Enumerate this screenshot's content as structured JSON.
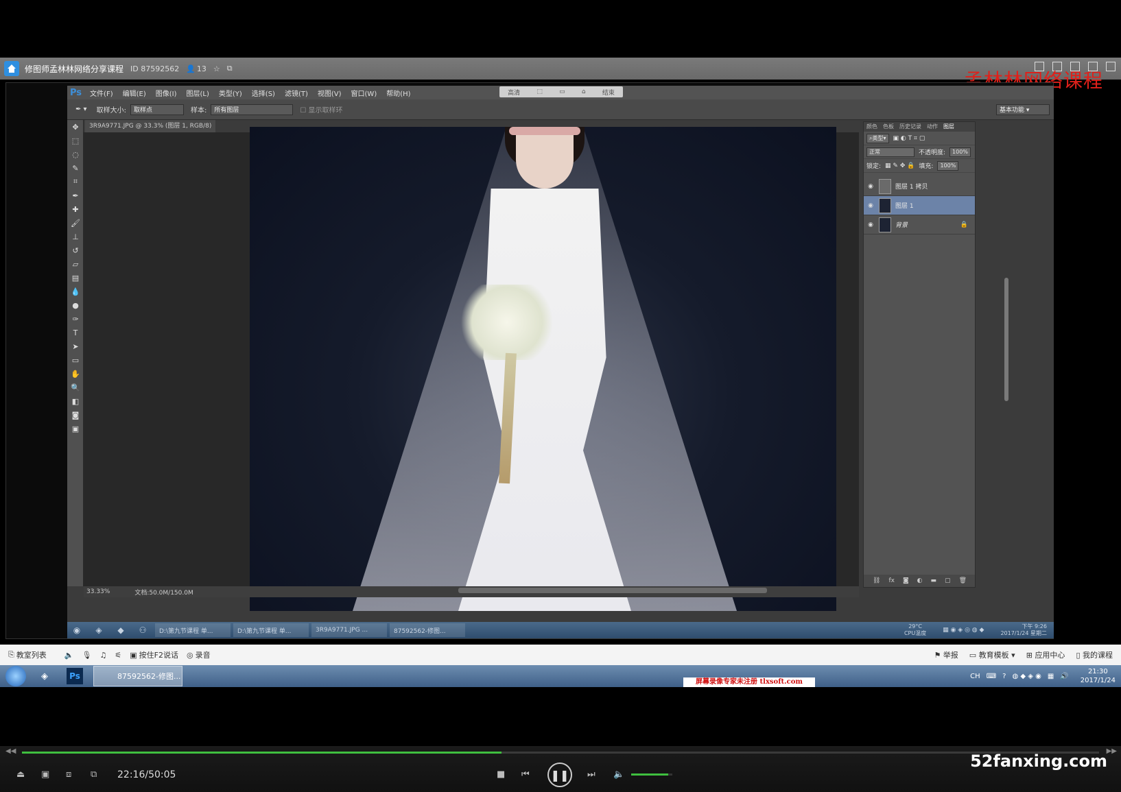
{
  "window": {
    "title": "修图师孟林林网络分享课程",
    "id_label": "ID 87592562",
    "viewer_count": "13",
    "overlay_watermark": "孟林林网络课程"
  },
  "photoshop": {
    "logo": "Ps",
    "menus": [
      "文件(F)",
      "编辑(E)",
      "图像(I)",
      "图层(L)",
      "类型(Y)",
      "选择(S)",
      "滤镜(T)",
      "视图(V)",
      "窗口(W)",
      "帮助(H)"
    ],
    "float_toolbar": [
      "高清",
      "",
      "",
      "",
      "结束"
    ],
    "options": {
      "sample_size_label": "取样大小:",
      "sample_size_value": "取样点",
      "sample_label": "样本:",
      "sample_value": "所有图层",
      "show_ring_label": "显示取样环",
      "workspace": "基本功能"
    },
    "document_tab": "3R9A9771.JPG @ 33.3% (图层 1, RGB/8) *",
    "status": {
      "zoom": "33.33%",
      "doc_info": "文档:50.0M/150.0M"
    },
    "layers_panel": {
      "tabs": [
        "颜色",
        "色板",
        "历史记录",
        "动作",
        "图层"
      ],
      "active_tab": "图层",
      "filter_label": "类型",
      "blend_mode": "正常",
      "opacity_label": "不透明度:",
      "opacity_value": "100%",
      "lock_label": "锁定:",
      "fill_label": "填充:",
      "fill_value": "100%",
      "layers": [
        {
          "name": "图层 1 拷贝",
          "selected": false,
          "locked": false
        },
        {
          "name": "图层 1",
          "selected": true,
          "locked": false
        },
        {
          "name": "背景",
          "selected": false,
          "locked": true
        }
      ]
    }
  },
  "inner_taskbar": {
    "items": [
      "D:\\第九节课程 单...",
      "D:\\第九节课程 单...",
      "3R9A9771.JPG ...",
      "87592562-修图..."
    ],
    "temp": "29°C",
    "temp_label": "CPU温度",
    "clock_time": "下午 9:26",
    "clock_date": "2017/1/24 星期二"
  },
  "yy_controls": {
    "classroom_list": "教室列表",
    "f2_talk": "按住F2说话",
    "record": "录音",
    "report": "举报",
    "edu_template": "教育模板",
    "app_center": "应用中心",
    "my_courses": "我的课程"
  },
  "host_taskbar": {
    "active_app": "87592562-修图...",
    "lang": "CH",
    "time": "21:30",
    "date": "2017/1/24",
    "reg_watermark": "屏幕录像专家未注册 tlxsoft.com"
  },
  "player": {
    "time_display": "22:16/50:05",
    "progress": 0.445,
    "volume": 0.9,
    "site_watermark": "52fanxing.com"
  },
  "colors": {
    "progress_green": "#3fbf3f",
    "watermark_red": "#e0201a",
    "layer_selected": "#6c83a8"
  }
}
